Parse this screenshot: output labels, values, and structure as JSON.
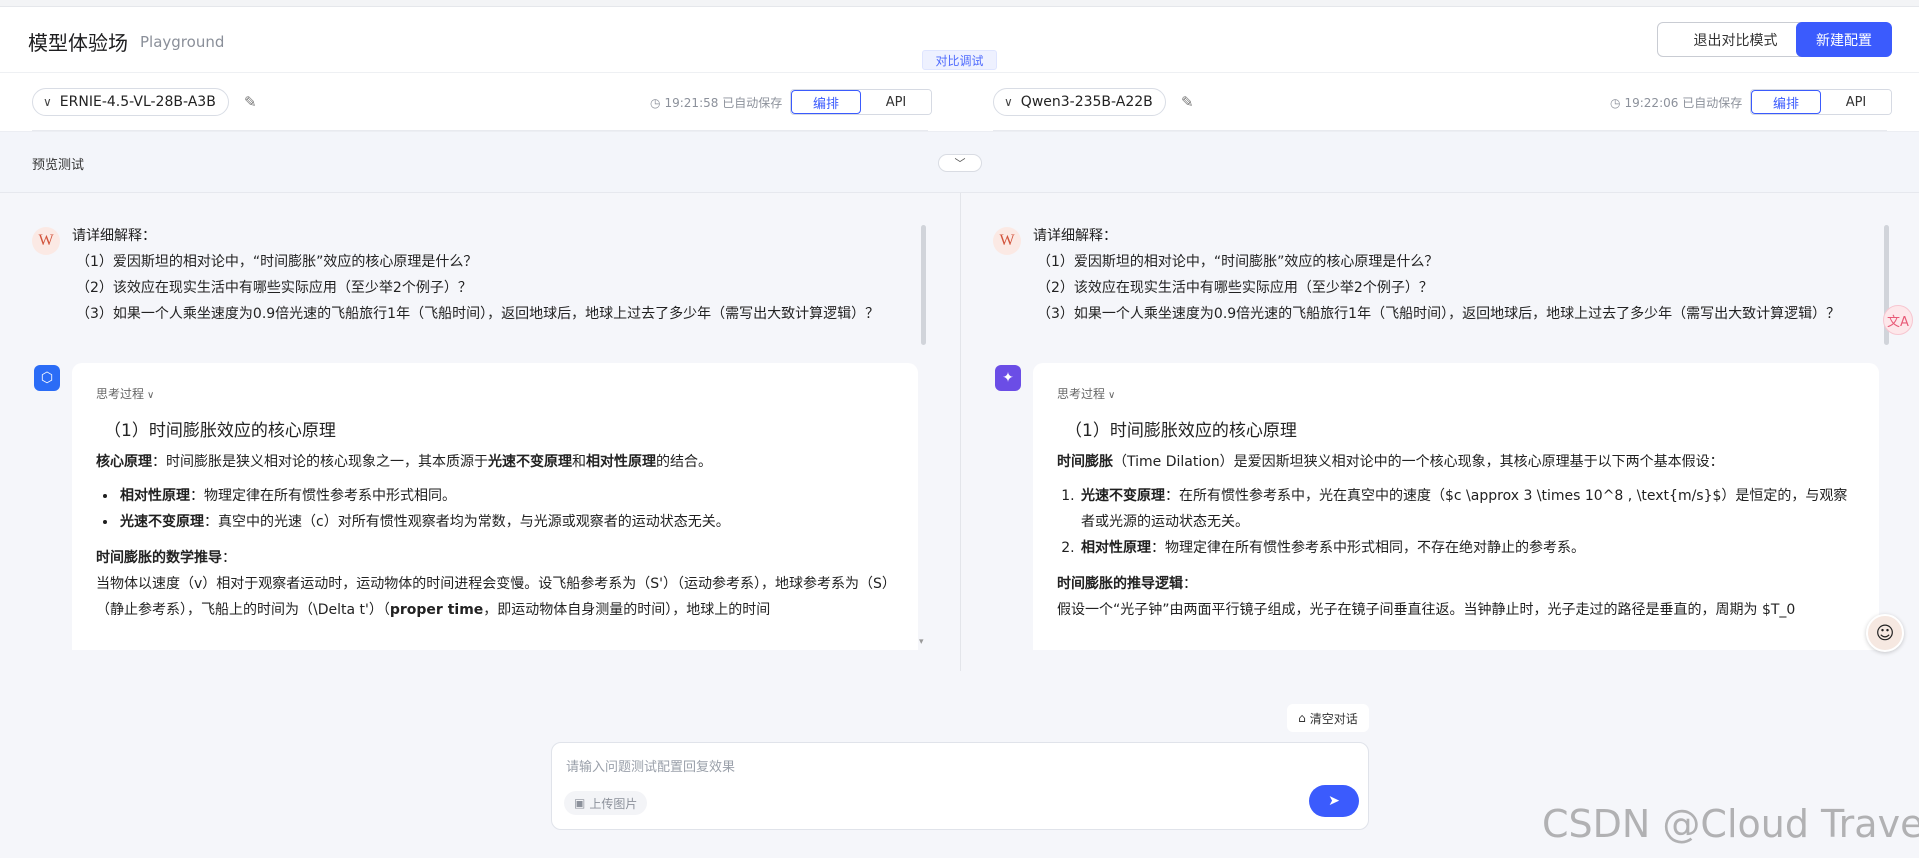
{
  "header": {
    "title": "模型体验场",
    "subtitle": "Playground",
    "exit_compare_label": "退出对比模式",
    "new_config_label": "新建配置",
    "compare_badge": "对比调试"
  },
  "left_model": {
    "name": "ERNIE-4.5-VL-28B-A3B",
    "saved_text": "19:21:58 已自动保存",
    "tab_edit": "编排",
    "tab_api": "API"
  },
  "right_model": {
    "name": "Qwen3-235B-A22B",
    "saved_text": "19:22:06 已自动保存",
    "tab_edit": "编排",
    "tab_api": "API"
  },
  "preview": {
    "label": "预览测试",
    "collapse_icon": "chevron-down-icon"
  },
  "user_message": {
    "avatar_letter": "W",
    "lines": [
      "请详细解释：",
      "（1）爱因斯坦的相对论中，“时间膨胀”效应的核心原理是什么？",
      "（2）该效应在现实生活中有哪些实际应用（至少举2个例子）？",
      "（3）如果一个人乘坐速度为0.9倍光速的飞船旅行1年（飞船时间），返回地球后，地球上过去了多少年（需写出大致计算逻辑）？"
    ]
  },
  "left_answer": {
    "think_label": "思考过程",
    "heading": "（1）时间膨胀效应的核心原理",
    "intro_bold1": "核心原理",
    "intro_rest": "：时间膨胀是狭义相对论的核心现象之一，其本质源于",
    "intro_bold2": "光速不变原理",
    "intro_and": "和",
    "intro_bold3": "相对性原理",
    "intro_end": "的结合。",
    "bullets": [
      {
        "bold": "相对性原理",
        "text": "：物理定律在所有惯性参考系中形式相同。"
      },
      {
        "bold": "光速不变原理",
        "text": "：真空中的光速（c）对所有惯性观察者均为常数，与光源或观察者的运动状态无关。"
      }
    ],
    "section_title": "时间膨胀的数学推导",
    "section_colon": "：",
    "para1": "当物体以速度（v）相对于观察者运动时，运动物体的时间进程会变慢。设飞船参考系为（S'）（运动参考系），地球参考系为（S）（静止参考系），飞船上的时间为（\\Delta t'）（",
    "para1_bold": "proper time",
    "para1_end": "，即运动物体自身测量的时间），地球上的时间"
  },
  "right_answer": {
    "think_label": "思考过程",
    "heading": "（1）时间膨胀效应的核心原理",
    "intro_bold1": "时间膨胀",
    "intro_rest": "（Time Dilation）是爱因斯坦狭义相对论中的一个核心现象，其核心原理基于以下两个基本假设：",
    "items": [
      {
        "bold": "光速不变原理",
        "text": "：在所有惯性参考系中，光在真空中的速度（$c \\approx 3 \\times 10^8 , \\text{m/s}$）是恒定的，与观察者或光源的运动状态无关。"
      },
      {
        "bold": "相对性原理",
        "text": "：物理定律在所有惯性参考系中形式相同，不存在绝对静止的参考系。"
      }
    ],
    "section_title": "时间膨胀的推导逻辑",
    "section_colon": "：",
    "para1": "假设一个“光子钟”由两面平行镜子组成，光子在镜子间垂直往返。当钟静止时，光子走过的路径是垂直的，周期为 $T_0"
  },
  "side": {
    "translate_glyph": "文A",
    "assistant_avatar": "☺"
  },
  "input": {
    "clear_label": "清空对话",
    "placeholder": "请输入问题测试配置回复效果",
    "upload_label": "上传图片"
  },
  "watermark": "CSDN @Cloud Traveler",
  "colors": {
    "accent": "#3b5bfd",
    "ernie_brand": "#2b6cf6",
    "qwen_brand": "#6b4de6"
  }
}
